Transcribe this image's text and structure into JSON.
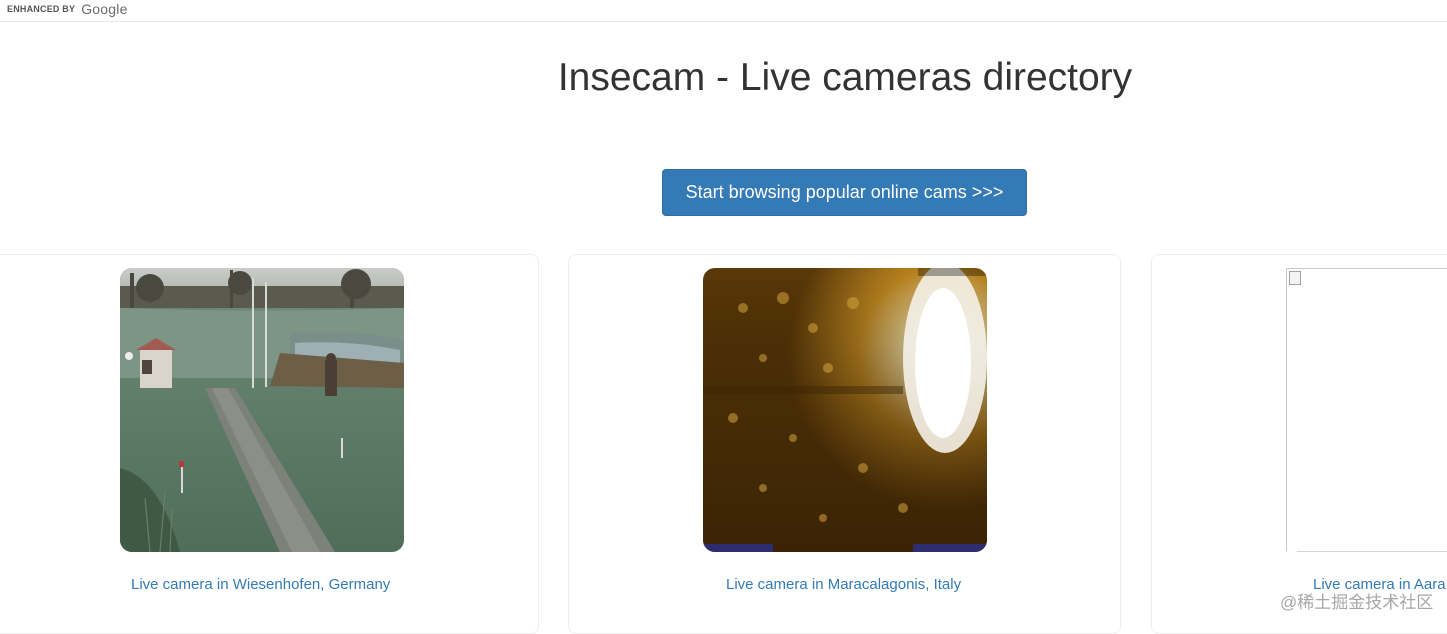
{
  "topbar": {
    "enhanced_label": "ENHANCED BY",
    "google_label": "Google"
  },
  "page_title": "Insecam - Live cameras directory",
  "cta_label": "Start browsing popular online cams >>>",
  "cameras": [
    {
      "caption": "Live camera in Wiesenhofen, Germany"
    },
    {
      "caption": "Live camera in Maracalagonis, Italy"
    },
    {
      "caption": "Live camera in Aara"
    }
  ],
  "watermark": "@稀土掘金技术社区",
  "colors": {
    "link": "#337ab7",
    "button_bg": "#337ab7",
    "title": "#333333"
  }
}
